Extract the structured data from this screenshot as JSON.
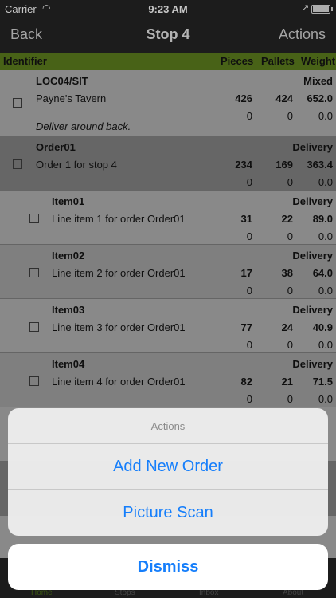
{
  "status_bar": {
    "carrier": "Carrier",
    "time": "9:23 AM"
  },
  "nav": {
    "back_label": "Back",
    "title": "Stop 4",
    "actions_label": "Actions"
  },
  "columns": {
    "identifier": "Identifier",
    "pieces": "Pieces",
    "pallets": "Pallets",
    "weight": "Weight"
  },
  "rows": [
    {
      "id": "LOC04/SIT",
      "type": "Mixed",
      "desc": "Payne's Tavern",
      "pieces": "426",
      "pallets": "424",
      "weight": "652.0",
      "pieces2": "0",
      "pallets2": "0",
      "weight2": "0.0",
      "note": "Deliver around back."
    },
    {
      "id": "Order01",
      "type": "Delivery",
      "desc": "Order 1 for stop 4",
      "pieces": "234",
      "pallets": "169",
      "weight": "363.4",
      "pieces2": "0",
      "pallets2": "0",
      "weight2": "0.0"
    },
    {
      "id": "Item01",
      "type": "Delivery",
      "desc": "Line item 1 for order Order01",
      "pieces": "31",
      "pallets": "22",
      "weight": "89.0",
      "pieces2": "0",
      "pallets2": "0",
      "weight2": "0.0"
    },
    {
      "id": "Item02",
      "type": "Delivery",
      "desc": "Line item 2 for order Order01",
      "pieces": "17",
      "pallets": "38",
      "weight": "64.0",
      "pieces2": "0",
      "pallets2": "0",
      "weight2": "0.0"
    },
    {
      "id": "Item03",
      "type": "Delivery",
      "desc": "Line item 3 for order Order01",
      "pieces": "77",
      "pallets": "24",
      "weight": "40.9",
      "pieces2": "0",
      "pallets2": "0",
      "weight2": "0.0"
    },
    {
      "id": "Item04",
      "type": "Delivery",
      "desc": "Line item 4 for order Order01",
      "pieces": "82",
      "pallets": "21",
      "weight": "71.5",
      "pieces2": "0",
      "pallets2": "0",
      "weight2": "0.0"
    }
  ],
  "tabs": {
    "home": "Home",
    "stops": "Stops",
    "inbox": "Inbox",
    "about": "About"
  },
  "action_sheet": {
    "title": "Actions",
    "add_new_order": "Add New Order",
    "picture_scan": "Picture Scan",
    "dismiss": "Dismiss"
  }
}
